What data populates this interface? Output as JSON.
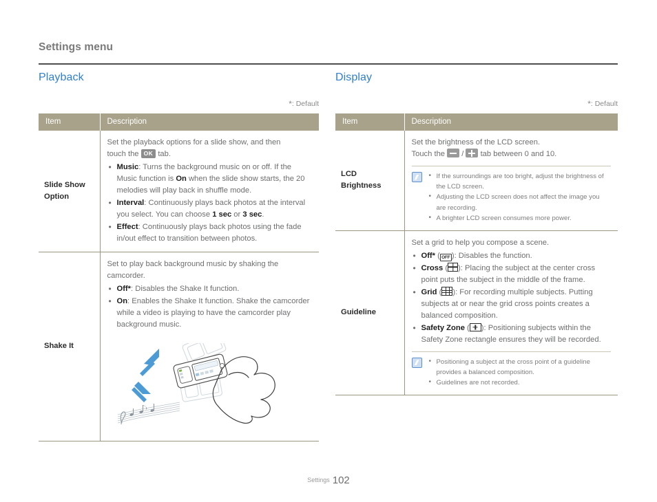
{
  "header": {
    "title": "Settings menu"
  },
  "footer": {
    "label": "Settings",
    "page": "102"
  },
  "colors": {
    "accent": "#2f7fd0",
    "table_header": "#a8a28a",
    "note_icon": "#5d8fc9"
  },
  "left": {
    "section_title": "Playback",
    "default_note_star": "*",
    "default_note_text": ": Default",
    "columns": {
      "item": "Item",
      "description": "Description"
    },
    "rows": [
      {
        "item": "Slide Show Option",
        "lead_a": "Set the playback options for a slide show, and then",
        "lead_b": "touch the",
        "chip_ok": "OK",
        "lead_c": "tab.",
        "bullets": [
          {
            "term": "Music",
            "sep": ":",
            "text": " Turns the background music on or off. If the Music function is ",
            "bold_mid": "On",
            "text2": " when the slide show starts, the 20 melodies will play back in shuffle mode."
          },
          {
            "term": "Interval",
            "sep": ":",
            "text": " Continuously plays back photos at the interval you select. You can choose ",
            "bold_mid": "1 sec",
            "text2": " or ",
            "bold_end": "3 sec",
            "text3": "."
          },
          {
            "term": "Effect",
            "sep": ":",
            "text": " Continuously plays back photos using the fade in/out effect to transition between photos."
          }
        ]
      },
      {
        "item": "Shake It",
        "lead_a": "Set to play back background music by shaking the camcorder.",
        "bullets": [
          {
            "term": "Off*",
            "sep": ":",
            "text": " Disables the Shake It function."
          },
          {
            "term": "On",
            "sep": ":",
            "text": "  Enables the Shake It function. Shake the camcorder while a video is playing to have the camcorder play background music."
          }
        ],
        "illustration": "hand-shaking-camcorder-with-music-notes"
      }
    ]
  },
  "right": {
    "section_title": "Display",
    "default_note_star": "*",
    "default_note_text": ": Default",
    "columns": {
      "item": "Item",
      "description": "Description"
    },
    "rows": [
      {
        "item": "LCD Brightness",
        "lead_a": "Set the brightness of the LCD screen.",
        "lead_b": "Touch the",
        "chip_minus": "minus-button-icon",
        "chip_sep": "/",
        "chip_plus": "plus-button-icon",
        "lead_c": "tab between 0 and 10.",
        "notes": [
          "If the surroundings are too bright, adjust the brightness of the LCD screen.",
          "Adjusting the LCD screen does not affect the image you are recording.",
          "A brighter LCD screen consumes more power."
        ]
      },
      {
        "item": "Guideline",
        "lead_a": "Set a grid to help you compose a scene.",
        "bullets": [
          {
            "term": "Off*",
            "icon": "off-icon",
            "text": "): Disables the function."
          },
          {
            "term": "Cross",
            "icon": "cross-grid-icon",
            "text": "): Placing the subject at the center cross point puts the subject in the middle of the frame."
          },
          {
            "term": "Grid",
            "icon": "grid-3x3-icon",
            "text": "): For recording multiple subjects. Putting subjects at or near the grid cross points creates a balanced composition."
          },
          {
            "term": "Safety Zone",
            "icon": "safety-zone-icon",
            "text": "): Positioning subjects within the Safety Zone rectangle ensures they will be recorded."
          }
        ],
        "notes": [
          "Positioning a subject at the cross point of a guideline provides a balanced composition.",
          "Guidelines are not recorded."
        ]
      }
    ]
  }
}
